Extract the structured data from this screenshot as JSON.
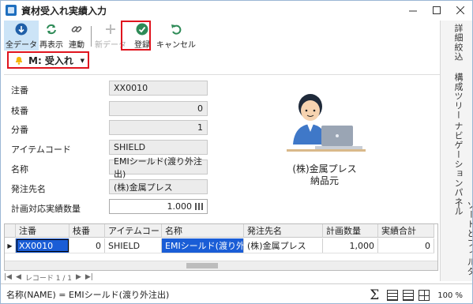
{
  "window": {
    "title": "資材受入れ実績入力"
  },
  "toolbar": {
    "all_data": "全データ",
    "refresh": "再表示",
    "link": "連動",
    "new_data": "新データ",
    "register": "登録",
    "cancel": "キャンセル"
  },
  "mode": {
    "label": "M: 受入れ"
  },
  "form": {
    "order_no_label": "注番",
    "order_no": "XX0010",
    "branch_label": "枝番",
    "branch": "0",
    "split_label": "分番",
    "split": "1",
    "item_code_label": "アイテムコード",
    "item_code": "SHIELD",
    "name_label": "名称",
    "name": "EMIシールド(渡り外注出)",
    "supplier_label": "発注先名",
    "supplier": "(株)金属プレス",
    "qty_label": "計画対応実績数量",
    "qty": "1.000"
  },
  "illustration": {
    "line1": "(株)金属プレス",
    "line2": "納品元"
  },
  "side_tabs": [
    "詳細絞込",
    "構成ツリー",
    "ナビゲーションパネル",
    "ソートとフィルター"
  ],
  "grid": {
    "columns": [
      "注番",
      "枝番",
      "アイテムコード",
      "名称",
      "発注先名",
      "計画数量",
      "実績合計"
    ],
    "rows": [
      [
        "XX0010",
        "0",
        "SHIELD",
        "EMIシールド(渡り外...",
        "(株)金属プレス",
        "1,000",
        "0"
      ]
    ]
  },
  "pager": {
    "record": "レコード 1 / 1"
  },
  "status": {
    "text": "名称(NAME) = EMIシールド(渡り外注出)",
    "zoom": "100 %"
  }
}
